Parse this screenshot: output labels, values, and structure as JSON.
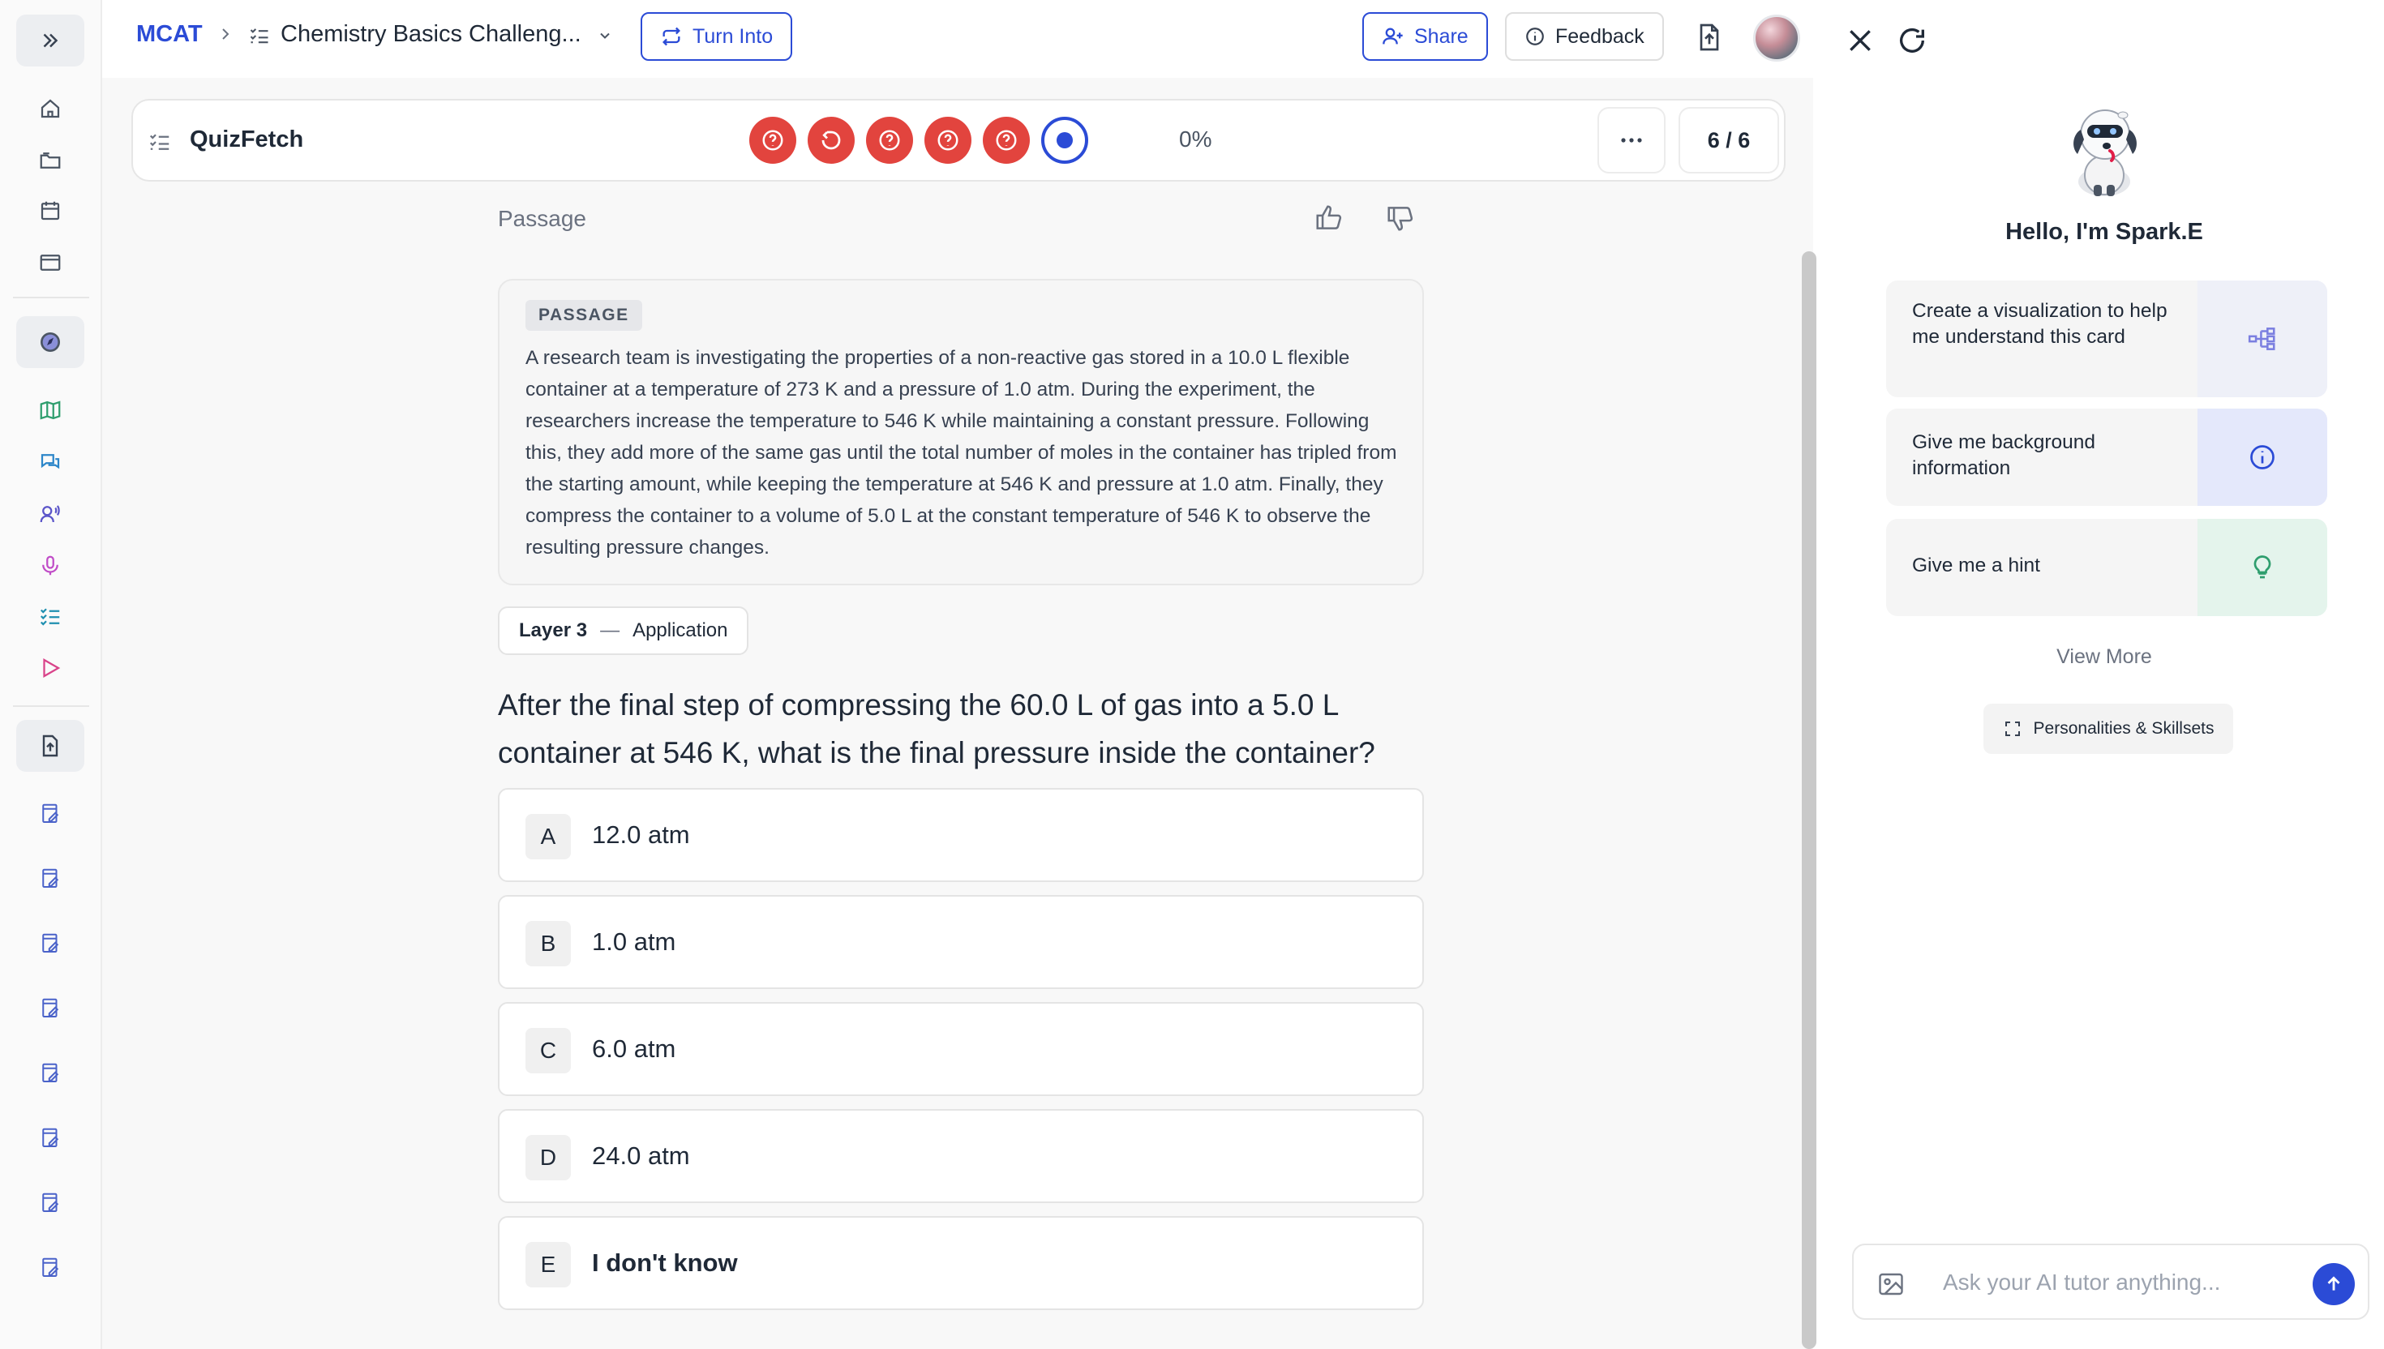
{
  "breadcrumb": {
    "root": "MCAT",
    "title": "Chemistry Basics Challeng..."
  },
  "topbar": {
    "turn_into": "Turn Into",
    "share": "Share",
    "feedback": "Feedback"
  },
  "quiz": {
    "name": "QuizFetch",
    "percent": "0%",
    "counter": "6 / 6",
    "progress_states": [
      "unanswered",
      "retry",
      "unanswered",
      "unanswered",
      "unanswered",
      "current"
    ]
  },
  "content": {
    "section_label": "Passage",
    "passage_tag": "PASSAGE",
    "passage_text": "A research team is investigating the properties of a non-reactive gas stored in a 10.0 L flexible container at a temperature of 273 K and a pressure of 1.0 atm. During the experiment, the researchers increase the temperature to 546 K while maintaining a constant pressure. Following this, they add more of the same gas until the total number of moles in the container has tripled from the starting amount, while keeping the temperature at 546 K and pressure at 1.0 atm. Finally, they compress the container to a volume of 5.0 L at the constant temperature of 546 K to observe the resulting pressure changes.",
    "layer_label": "Layer 3",
    "layer_dash": "—",
    "layer_name": "Application",
    "question": "After the final step of compressing the 60.0 L of gas into a 5.0 L container at 546 K, what is the final pressure inside the container?",
    "options": [
      {
        "letter": "A",
        "text": "12.0 atm"
      },
      {
        "letter": "B",
        "text": "1.0 atm"
      },
      {
        "letter": "C",
        "text": "6.0 atm"
      },
      {
        "letter": "D",
        "text": "24.0 atm"
      },
      {
        "letter": "E",
        "text": "I don't know"
      }
    ]
  },
  "tutor": {
    "greeting": "Hello, I'm Spark.E",
    "suggestions": [
      {
        "text": "Create a visualization to help me understand this card",
        "icon": "diagram-icon"
      },
      {
        "text": "Give me background information",
        "icon": "info-icon"
      },
      {
        "text": "Give me a hint",
        "icon": "lightbulb-icon"
      }
    ],
    "view_more": "View More",
    "personalities": "Personalities & Skillsets",
    "input_placeholder": "Ask your AI tutor anything..."
  },
  "colors": {
    "accent": "#2b4bd6",
    "wrong": "#e2443e",
    "suggestion_1_bg": "#eef0f8",
    "suggestion_2_bg": "#e4e8fb",
    "suggestion_3_bg": "#e4f4ec"
  }
}
